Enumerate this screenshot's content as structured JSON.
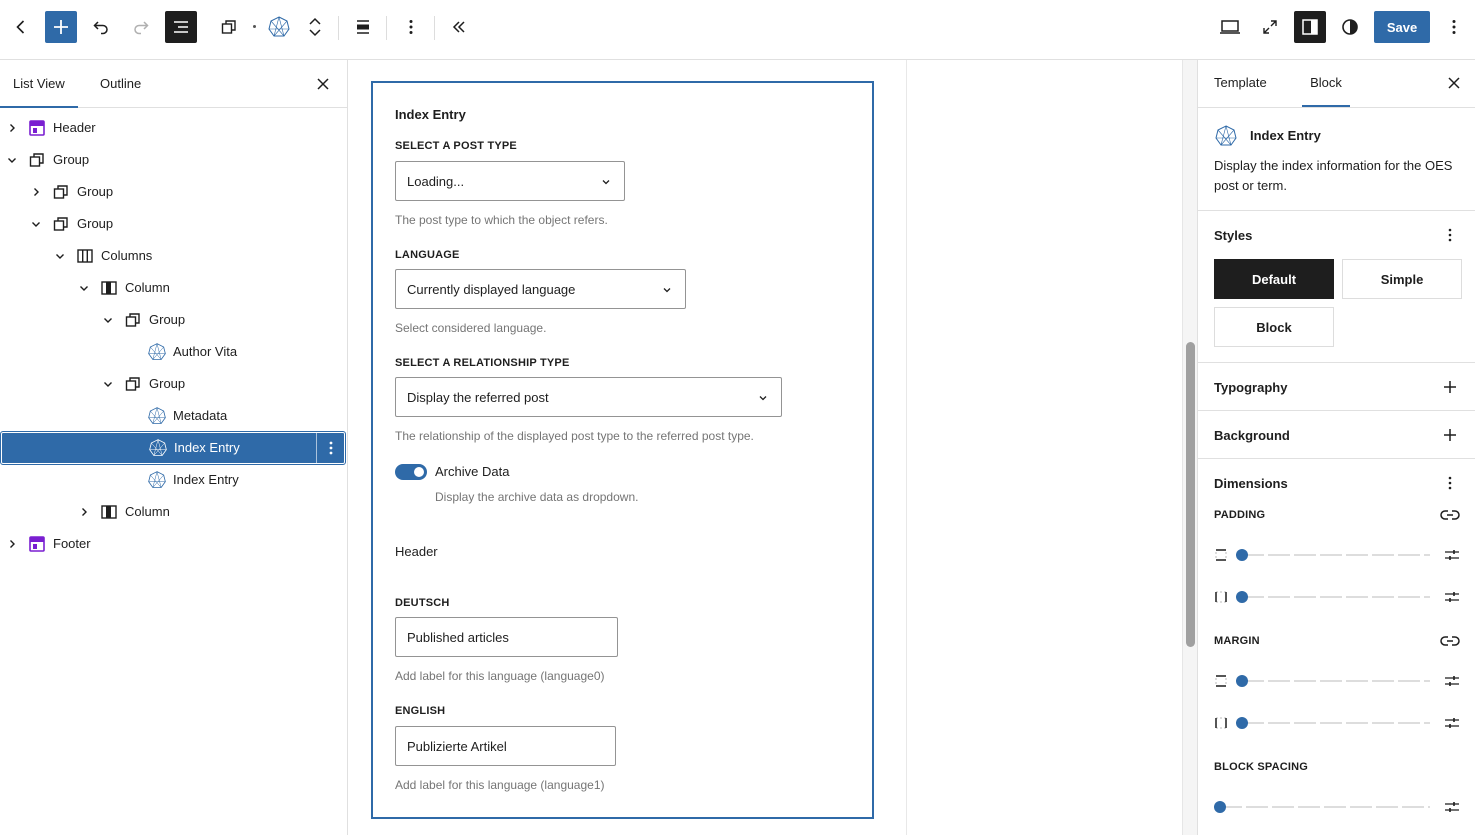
{
  "toolbar": {
    "save_label": "Save"
  },
  "list_panel": {
    "tabs": [
      "List View",
      "Outline"
    ],
    "items": [
      {
        "label": "Header",
        "depth": 0,
        "expand": "collapsed",
        "icon": "template-part-icon"
      },
      {
        "label": "Group",
        "depth": 0,
        "expand": "expanded",
        "icon": "group-icon"
      },
      {
        "label": "Group",
        "depth": 1,
        "expand": "collapsed",
        "icon": "group-icon"
      },
      {
        "label": "Group",
        "depth": 1,
        "expand": "expanded",
        "icon": "group-icon"
      },
      {
        "label": "Columns",
        "depth": 2,
        "expand": "expanded",
        "icon": "columns-icon"
      },
      {
        "label": "Column",
        "depth": 3,
        "expand": "expanded",
        "icon": "column-icon"
      },
      {
        "label": "Group",
        "depth": 4,
        "expand": "expanded",
        "icon": "group-icon"
      },
      {
        "label": "Author Vita",
        "depth": 5,
        "expand": "none",
        "icon": "oes-icon"
      },
      {
        "label": "Group",
        "depth": 4,
        "expand": "expanded",
        "icon": "group-icon"
      },
      {
        "label": "Metadata",
        "depth": 5,
        "expand": "none",
        "icon": "oes-icon"
      },
      {
        "label": "Index Entry",
        "depth": 5,
        "expand": "none",
        "icon": "oes-icon",
        "selected": true
      },
      {
        "label": "Index Entry",
        "depth": 5,
        "expand": "none",
        "icon": "oes-icon"
      },
      {
        "label": "Column",
        "depth": 3,
        "expand": "collapsed",
        "icon": "column-icon"
      },
      {
        "label": "Footer",
        "depth": 0,
        "expand": "collapsed",
        "icon": "template-part-icon"
      }
    ]
  },
  "block_form": {
    "title": "Index Entry",
    "post_type": {
      "label": "Select a post type",
      "value": "Loading...",
      "help": "The post type to which the object refers."
    },
    "language": {
      "label": "Language",
      "value": "Currently displayed language",
      "help": "Select considered language."
    },
    "relationship": {
      "label": "Select a relationship type",
      "value": "Display the referred post",
      "help": "The relationship of the displayed post type to the referred post type."
    },
    "archive": {
      "label": "Archive Data",
      "help": "Display the archive data as dropdown.",
      "enabled": true
    },
    "header_label": "Header",
    "deutsch": {
      "label": "Deutsch",
      "value": "Published articles",
      "help": "Add label for this language (language0)"
    },
    "english": {
      "label": "English",
      "value": "Publizierte Artikel",
      "help": "Add label for this language (language1)"
    }
  },
  "settings_panel": {
    "tabs": [
      "Template",
      "Block"
    ],
    "active_tab": "Block",
    "block_name": "Index Entry",
    "block_description": "Display the index information for the OES post or term.",
    "styles": {
      "title": "Styles",
      "options": [
        "Default",
        "Simple",
        "Block"
      ],
      "active": "Default"
    },
    "typography": "Typography",
    "background": "Background",
    "dimensions": {
      "title": "Dimensions",
      "padding": "Padding",
      "margin": "Margin",
      "block_spacing": "Block spacing"
    }
  },
  "colors": {
    "accent": "#2f6aa8",
    "dark": "#1e1e1e",
    "template_part": "#7a1fd1"
  }
}
